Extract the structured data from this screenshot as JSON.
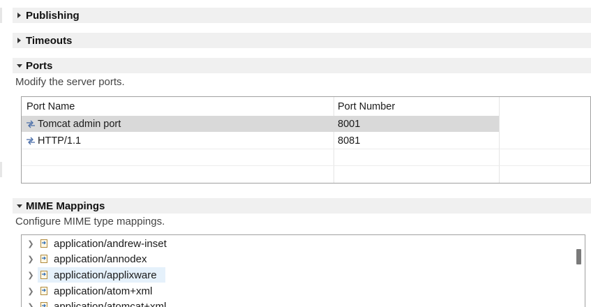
{
  "sections": {
    "publishing": {
      "title": "Publishing",
      "expanded": false
    },
    "timeouts": {
      "title": "Timeouts",
      "expanded": false
    },
    "ports": {
      "title": "Ports",
      "expanded": true,
      "description": "Modify the server ports."
    },
    "mime": {
      "title": "MIME Mappings",
      "expanded": true,
      "description": "Configure MIME type mappings."
    }
  },
  "ports_table": {
    "columns": [
      "Port Name",
      "Port Number"
    ],
    "rows": [
      {
        "name": "Tomcat admin port",
        "number": "8001",
        "selected": true,
        "icon": "port-icon"
      },
      {
        "name": "HTTP/1.1",
        "number": "8081",
        "selected": false,
        "icon": "port-icon"
      }
    ]
  },
  "mime_mappings": {
    "items": [
      {
        "label": "application/andrew-inset",
        "icon": "mime-mapping-icon"
      },
      {
        "label": "application/annodex",
        "icon": "mime-mapping-icon"
      },
      {
        "label": "application/applixware",
        "icon": "mime-mapping-icon",
        "highlighted": true
      },
      {
        "label": "application/atom+xml",
        "icon": "mime-mapping-icon"
      },
      {
        "label": "application/atomcat+xml",
        "icon": "mime-mapping-icon"
      }
    ]
  },
  "colors": {
    "section_header_bg": "#f0f0f0",
    "selected_row_bg": "#d9d9d9",
    "hover_item_bg": "#e5f1fb"
  }
}
